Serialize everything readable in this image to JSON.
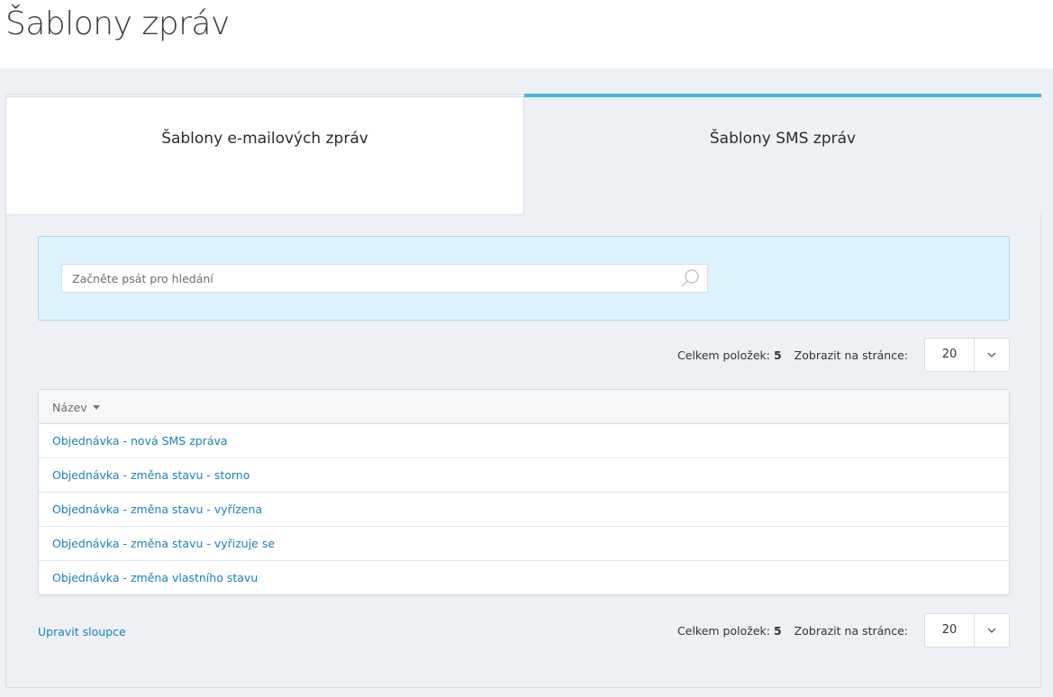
{
  "page": {
    "title": "Šablony zpráv"
  },
  "tabs": [
    {
      "label": "Šablony e-mailových zpráv",
      "active": false
    },
    {
      "label": "Šablony SMS zpráv",
      "active": true
    }
  ],
  "search": {
    "placeholder": "Začněte psát pro hledání",
    "value": "",
    "icon": "search-icon"
  },
  "pager": {
    "total_label": "Celkem položek:",
    "total_value": "5",
    "per_page_label": "Zobrazit na stránce:",
    "per_page_value": "20",
    "dropdown_icon": "chevron-down-icon"
  },
  "grid": {
    "columns": [
      {
        "label": "Název",
        "sort": "desc"
      }
    ],
    "rows": [
      "Objednávka - nová SMS zpráva",
      "Objednávka - změna stavu - storno",
      "Objednávka - změna stavu - vyřízena",
      "Objednávka - změna stavu - vyřizuje se",
      "Objednávka - změna vlastního stavu"
    ]
  },
  "footer": {
    "edit_columns_label": "Upravit sloupce"
  },
  "colors": {
    "accent": "#48b5e4",
    "link": "#1a82b5",
    "search_bg": "#dcf2fc",
    "page_bg": "#edf0f5"
  }
}
